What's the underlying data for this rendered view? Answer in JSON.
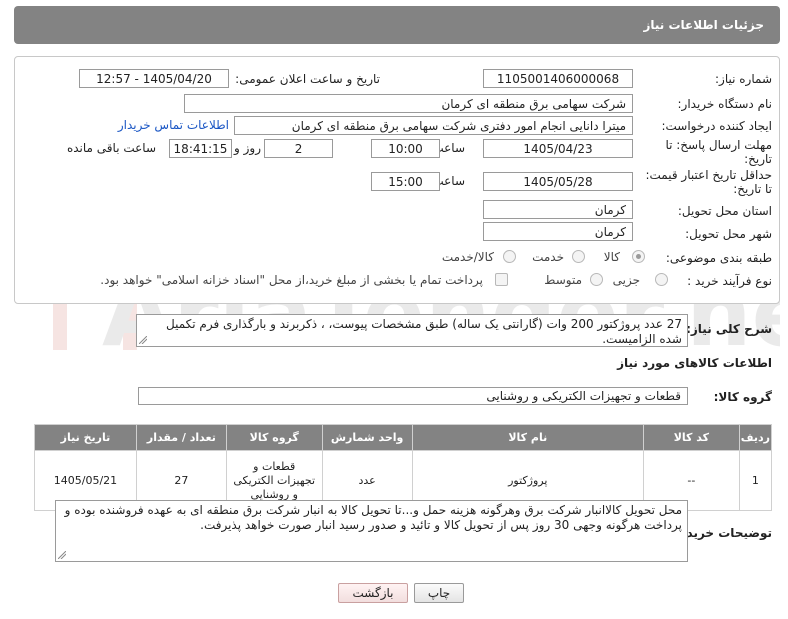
{
  "header": {
    "title": "جزئیات اطلاعات نیاز"
  },
  "form": {
    "need_number_label": "شماره نیاز:",
    "need_number": "1105001406000068",
    "announce_label": "تاریخ و ساعت اعلان عمومی:",
    "announce_value": "1405/04/20 - 12:57",
    "buyer_label": "نام دستگاه خریدار:",
    "buyer_value": "شرکت سهامی برق منطقه ای کرمان",
    "creator_label": "ایجاد کننده درخواست:",
    "creator_value": "میترا دانایی انجام امور دفتری شرکت سهامی برق منطقه ای کرمان",
    "contact_link": "اطلاعات تماس خریدار",
    "deadline_label_1": "مهلت ارسال پاسخ: تا",
    "deadline_label_2": "تاریخ:",
    "deadline_date": "1405/04/23",
    "time_label": "ساعت",
    "deadline_time": "10:00",
    "days_value": "2",
    "days_label": "روز و",
    "remaining_time": "18:41:15",
    "remaining_label": "ساعت باقی مانده",
    "min_validity_label_1": "حداقل تاریخ اعتبار قیمت:",
    "min_validity_label_2": "تا تاریخ:",
    "validity_date": "1405/05/28",
    "validity_time_label": "ساعت",
    "validity_time": "15:00",
    "province_label": "استان محل تحویل:",
    "province_value": "کرمان",
    "city_label": "شهر محل تحویل:",
    "city_value": "کرمان",
    "category_label": "طبقه بندی موضوعی:",
    "category_options": [
      "کالا",
      "خدمت",
      "کالا/خدمت"
    ],
    "category_selected": "کالا",
    "process_label": "نوع فرآیند خرید :",
    "process_options": [
      "جزیی",
      "متوسط"
    ],
    "payment_note": "پرداخت تمام یا بخشی از مبلغ خرید،از محل \"اسناد خزانه اسلامی\" خواهد بود."
  },
  "description": {
    "label": "شرح کلی نیاز:",
    "text": "27 عدد پروژکتور 200 وات (گارانتی یک ساله)  طبق مشخصات پیوست، ، ذکربرند و بارگذاری فرم تکمیل شده الزامیست."
  },
  "goods": {
    "section_title": "اطلاعات کالاهای مورد نیاز",
    "group_label": "گروه کالا:",
    "group_value": "قطعات و تجهیزات الکتریکی و روشنایی",
    "columns": [
      "ردیف",
      "کد کالا",
      "نام کالا",
      "واحد شمارش",
      "گروه کالا",
      "تعداد / مقدار",
      "تاریخ نیاز"
    ],
    "rows": [
      {
        "row": "1",
        "code": "--",
        "name": "پروژکتور",
        "unit": "عدد",
        "group": "قطعات و تجهیزات الکتریکی و روشنایی",
        "qty": "27",
        "date": "1405/05/21"
      }
    ]
  },
  "buyer_notes": {
    "label": "توضیحات خریدار:",
    "text": "محل تحویل کالاانبار شرکت برق وهرگونه هزینه حمل و...تا تحویل کالا به انبار شرکت برق منطقه ای به عهده فروشنده بوده و پرداخت هرگونه وجهی 30 روز پس از تحویل کالا و تائید و صدور رسید انبار صورت خواهد پذیرفت."
  },
  "buttons": {
    "print": "چاپ",
    "back": "بازگشت"
  },
  "watermark_text": "AriaTender.net"
}
